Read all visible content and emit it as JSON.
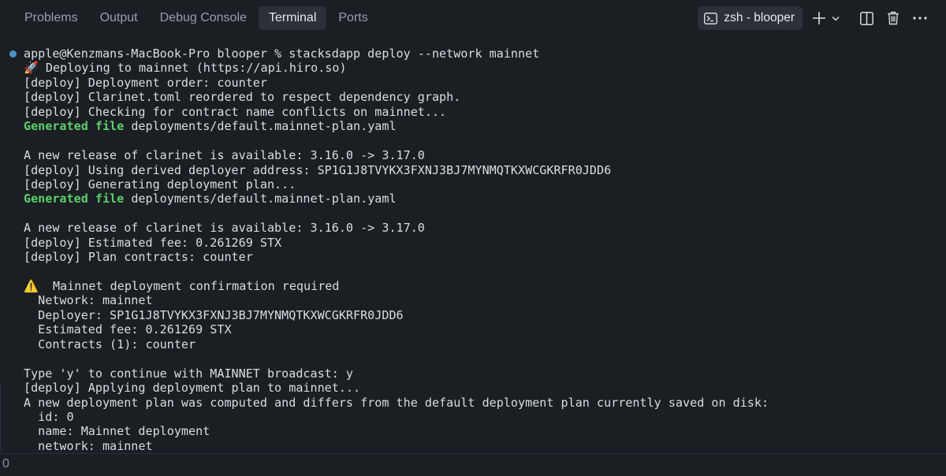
{
  "tabs": [
    {
      "label": "Problems",
      "active": false
    },
    {
      "label": "Output",
      "active": false
    },
    {
      "label": "Debug Console",
      "active": false
    },
    {
      "label": "Terminal",
      "active": true
    },
    {
      "label": "Ports",
      "active": false
    }
  ],
  "terminal_picker": {
    "icon": "terminal-icon",
    "label": "zsh - blooper"
  },
  "controls": [
    "add-terminal-icon",
    "chevron-down-icon",
    "split-terminal-icon",
    "trash-icon",
    "more-icon"
  ],
  "colors": {
    "background": "#1b1e23",
    "accent_green": "#5ad06b",
    "marker_blue": "#4f8fc9"
  },
  "terminal": {
    "lines": [
      {
        "text": "apple@Kenzmans-MacBook-Pro blooper % stacksdapp deploy --network mainnet"
      },
      {
        "text": "🚀 Deploying to mainnet (https://api.hiro.so)"
      },
      {
        "text": "[deploy] Deployment order: counter"
      },
      {
        "text": "[deploy] Clarinet.toml reordered to respect dependency graph."
      },
      {
        "text": "[deploy] Checking for contract name conflicts on mainnet..."
      },
      {
        "prefix": "Generated file",
        "text": " deployments/default.mainnet-plan.yaml"
      },
      {
        "text": ""
      },
      {
        "text": "A new release of clarinet is available: 3.16.0 -> 3.17.0"
      },
      {
        "text": "[deploy] Using derived deployer address: SP1G1J8TVYKX3FXNJ3BJ7MYNMQTKXWCGKRFR0JDD6"
      },
      {
        "text": "[deploy] Generating deployment plan..."
      },
      {
        "prefix": "Generated file",
        "text": " deployments/default.mainnet-plan.yaml"
      },
      {
        "text": ""
      },
      {
        "text": "A new release of clarinet is available: 3.16.0 -> 3.17.0"
      },
      {
        "text": "[deploy] Estimated fee: 0.261269 STX"
      },
      {
        "text": "[deploy] Plan contracts: counter"
      },
      {
        "text": ""
      },
      {
        "text": "⚠️  Mainnet deployment confirmation required"
      },
      {
        "text": "  Network: mainnet"
      },
      {
        "text": "  Deployer: SP1G1J8TVYKX3FXNJ3BJ7MYNMQTKXWCGKRFR0JDD6"
      },
      {
        "text": "  Estimated fee: 0.261269 STX"
      },
      {
        "text": "  Contracts (1): counter"
      },
      {
        "text": ""
      },
      {
        "text": "Type 'y' to continue with MAINNET broadcast: y"
      },
      {
        "text": "[deploy] Applying deployment plan to mainnet..."
      },
      {
        "text": "A new deployment plan was computed and differs from the default deployment plan currently saved on disk:"
      },
      {
        "text": "  id: 0"
      },
      {
        "text": "  name: Mainnet deployment"
      },
      {
        "text": "  network: mainnet"
      }
    ]
  },
  "bottom": {
    "value": "0"
  }
}
